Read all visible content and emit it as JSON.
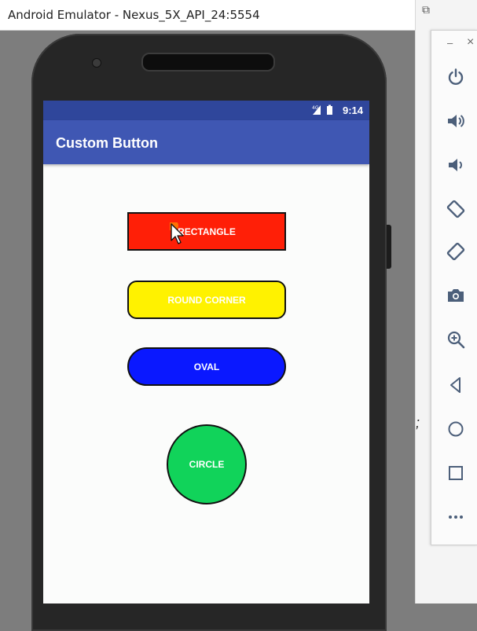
{
  "window": {
    "title": "Android Emulator - Nexus_5X_API_24:5554"
  },
  "phone": {
    "status_bar": {
      "time": "9:14",
      "color": "#2f469b"
    },
    "app_bar": {
      "title": "Custom Button",
      "color": "#3f57b3"
    },
    "buttons": [
      {
        "label": "RECTANGLE",
        "shape": "rectangle",
        "color": "#ff1f07"
      },
      {
        "label": "ROUND CORNER",
        "shape": "round-corner",
        "color": "#fff200"
      },
      {
        "label": "OVAL",
        "shape": "oval",
        "color": "#0a18ff"
      },
      {
        "label": "CIRCLE",
        "shape": "circle",
        "color": "#11d35a"
      }
    ]
  },
  "toolbar": {
    "items": [
      {
        "icon": "power-icon"
      },
      {
        "icon": "volume-up-icon"
      },
      {
        "icon": "volume-down-icon"
      },
      {
        "icon": "rotate-left-icon"
      },
      {
        "icon": "rotate-right-icon"
      },
      {
        "icon": "camera-icon"
      },
      {
        "icon": "zoom-icon"
      },
      {
        "icon": "back-icon"
      },
      {
        "icon": "home-icon"
      },
      {
        "icon": "overview-icon"
      },
      {
        "icon": "more-icon"
      }
    ]
  }
}
